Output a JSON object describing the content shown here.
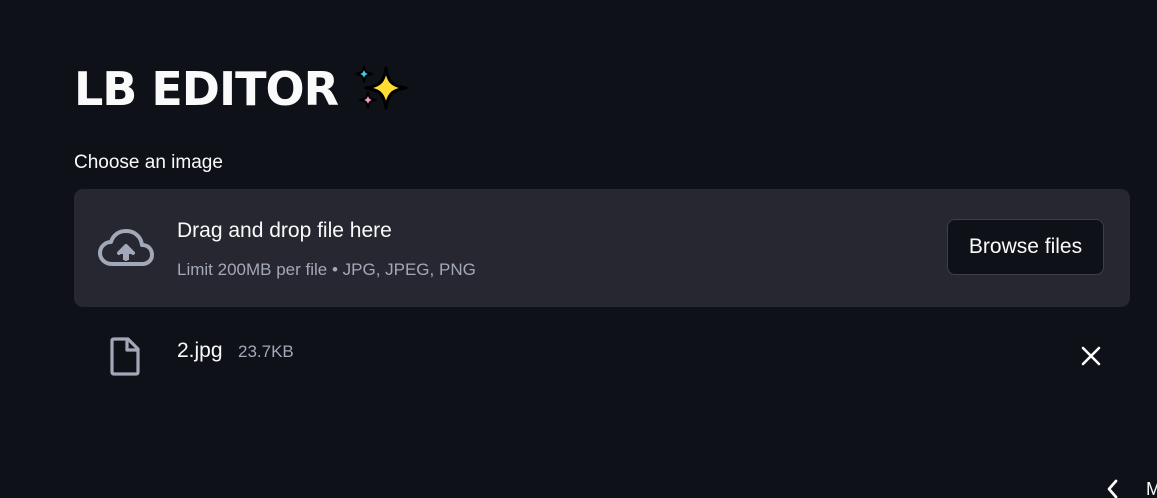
{
  "header": {
    "title": "LB EDITOR",
    "title_emoji_icon": "sparkles-icon"
  },
  "uploader": {
    "label": "Choose an image",
    "drop_text": "Drag and drop file here",
    "limit_text": "Limit 200MB per file • JPG, JPEG, PNG",
    "browse_label": "Browse files",
    "upload_icon": "cloud-upload-icon"
  },
  "uploaded_file": {
    "name": "2.jpg",
    "size": "23.7KB",
    "file_icon": "file-icon",
    "remove_icon": "close-icon"
  },
  "pagination": {
    "prev_icon": "chevron-left-icon",
    "partial_text": "M"
  },
  "colors": {
    "background": "#0e1117",
    "dropzone": "#262730",
    "text": "#fafafa",
    "muted_text": "#a3a8b8"
  }
}
